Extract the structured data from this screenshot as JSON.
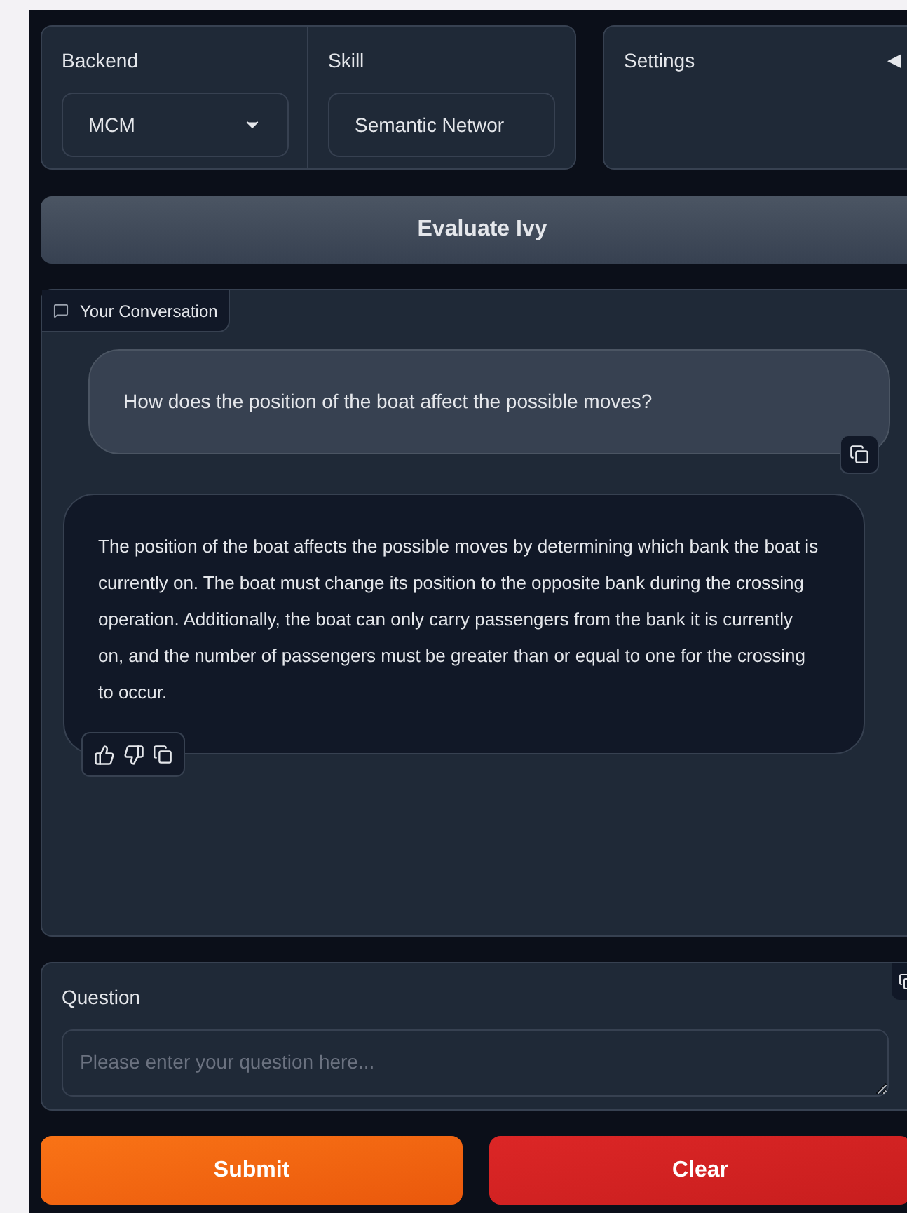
{
  "backend": {
    "label": "Backend",
    "value": "MCM"
  },
  "skill": {
    "label": "Skill",
    "value": "Semantic Networ"
  },
  "settings": {
    "title": "Settings",
    "collapse_glyph": "◀"
  },
  "evaluate_button": "Evaluate Ivy",
  "conversation": {
    "label": "Your Conversation",
    "messages": [
      {
        "kind": "user",
        "text": "How does the position of the boat affect the possible moves?"
      },
      {
        "kind": "bot",
        "text": "The position of the boat affects the possible moves by determining which bank the boat is currently on. The boat must change its position to the opposite bank during the crossing operation. Additionally, the boat can only carry passengers from the bank it is currently on, and the number of passengers must be greater than or equal to one for the crossing to occur."
      }
    ]
  },
  "question": {
    "label": "Question",
    "placeholder": "Please enter your question here..."
  },
  "buttons": [
    {
      "kind": "primary",
      "label": "Submit"
    },
    {
      "kind": "stop",
      "label": "Clear"
    }
  ]
}
